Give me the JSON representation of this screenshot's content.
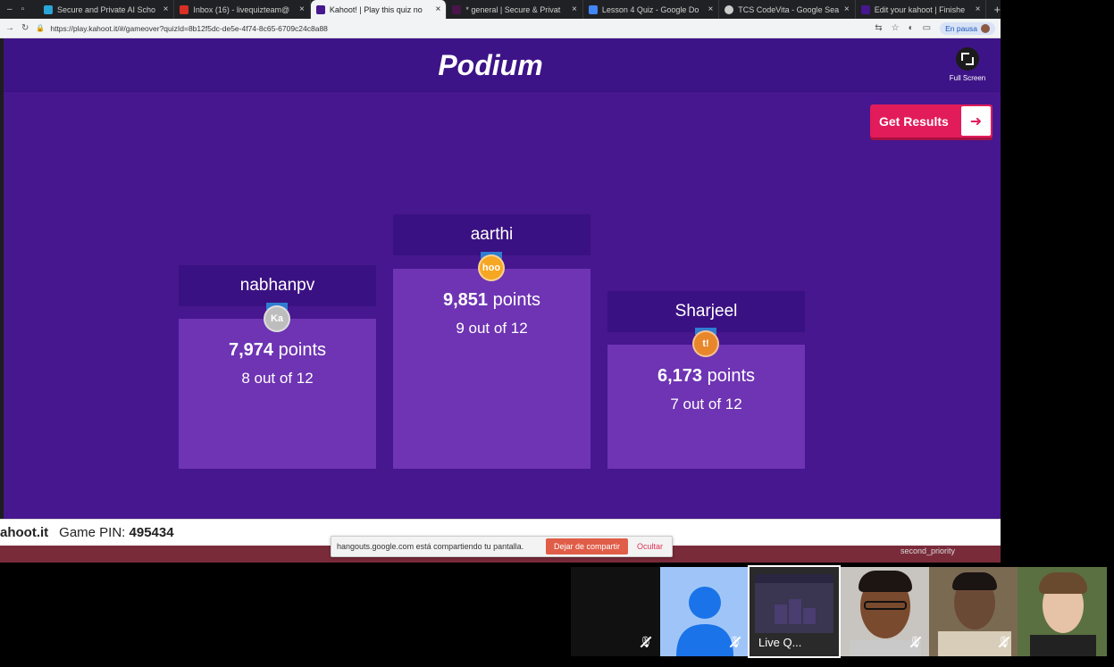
{
  "browser": {
    "tabs": [
      {
        "title": "Secure and Private AI Scho",
        "icon_color": "#2aa5d8",
        "active": false
      },
      {
        "title": "Inbox (16) - livequizteam@",
        "icon_color": "#d93025",
        "active": false
      },
      {
        "title": "Kahoot! | Play this quiz no",
        "icon_color": "#46178f",
        "active": true
      },
      {
        "title": "* general | Secure & Privat",
        "icon_color": "#4a154b",
        "active": false
      },
      {
        "title": "Lesson 4 Quiz - Google Do",
        "icon_color": "#4285f4",
        "active": false
      },
      {
        "title": "TCS CodeVita - Google Sea",
        "icon_color": "#cccccc",
        "active": false
      },
      {
        "title": "Edit your kahoot | Finishe",
        "icon_color": "#46178f",
        "active": false
      }
    ],
    "new_tab_icon": "+",
    "url": "https://play.kahoot.it/#/gameover?quizId=8b12f5dc-de5e-4f74-8c65-6709c24c8a88",
    "paused_label": "En pausa"
  },
  "kahoot": {
    "title": "Podium",
    "fullscreen_label": "Full Screen",
    "get_results_label": "Get Results",
    "podium": [
      {
        "place": 2,
        "name": "nabhanpv",
        "points": "7,974",
        "points_unit": "points",
        "correct": "8 out of 12",
        "medal_text": "Ka",
        "medal_color": "#bdbdbd"
      },
      {
        "place": 1,
        "name": "aarthi",
        "points": "9,851",
        "points_unit": "points",
        "correct": "9 out of 12",
        "medal_text": "hoo",
        "medal_color": "#f5a623"
      },
      {
        "place": 3,
        "name": "Sharjeel",
        "points": "6,173",
        "points_unit": "points",
        "correct": "7 out of 12",
        "medal_text": "t!",
        "medal_color": "#e8862a"
      }
    ],
    "brand": "ahoot.it",
    "game_pin_label": "Game PIN:",
    "game_pin": "495434"
  },
  "share_notice": {
    "message": "hangouts.google.com está compartiendo tu pantalla.",
    "stop_label": "Dejar de compartir",
    "hide_label": "Ocultar"
  },
  "tooltip": "second_priority",
  "meeting": {
    "presentation_label": "Live Q..."
  }
}
